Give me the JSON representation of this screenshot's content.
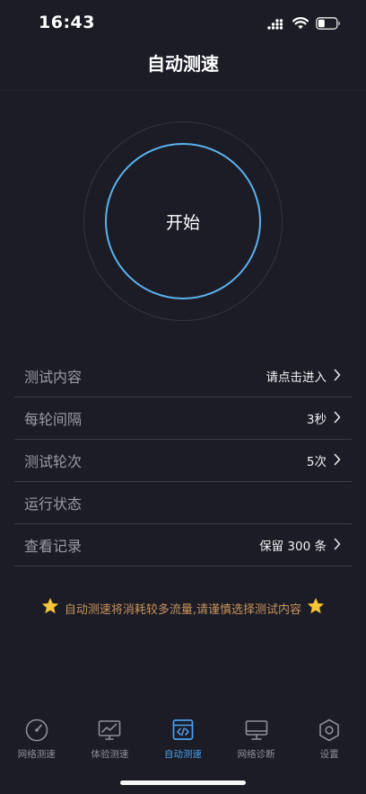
{
  "status_bar": {
    "time": "16:43",
    "icons": [
      "cellular-signal-icon",
      "wifi-icon",
      "battery-icon"
    ]
  },
  "header": {
    "title": "自动测速"
  },
  "dial": {
    "label": "开始"
  },
  "settings": {
    "rows": [
      {
        "label": "测试内容",
        "value": "请点击进入",
        "has_chevron": true
      },
      {
        "label": "每轮间隔",
        "value": "3秒",
        "has_chevron": true
      },
      {
        "label": "测试轮次",
        "value": "5次",
        "has_chevron": true
      },
      {
        "label": "运行状态",
        "value": "",
        "has_chevron": false
      },
      {
        "label": "查看记录",
        "value": "保留 300 条",
        "has_chevron": true
      }
    ]
  },
  "notice": {
    "text": "自动测速将消耗较多流量,请谨慎选择测试内容",
    "icon": "star-icon"
  },
  "tabs": [
    {
      "label": "网络测速",
      "icon": "speedometer-icon",
      "active": false
    },
    {
      "label": "体验测速",
      "icon": "chart-monitor-icon",
      "active": false
    },
    {
      "label": "自动测速",
      "icon": "code-window-icon",
      "active": true
    },
    {
      "label": "网络诊断",
      "icon": "desktop-monitor-icon",
      "active": false
    },
    {
      "label": "设置",
      "icon": "hexagon-gear-icon",
      "active": false
    }
  ],
  "colors": {
    "background": "#1b1c25",
    "accent": "#4b9ff0",
    "dial_ring": "#5bb2ee",
    "notice_text": "#c9935c",
    "star": "#f5c63a"
  }
}
